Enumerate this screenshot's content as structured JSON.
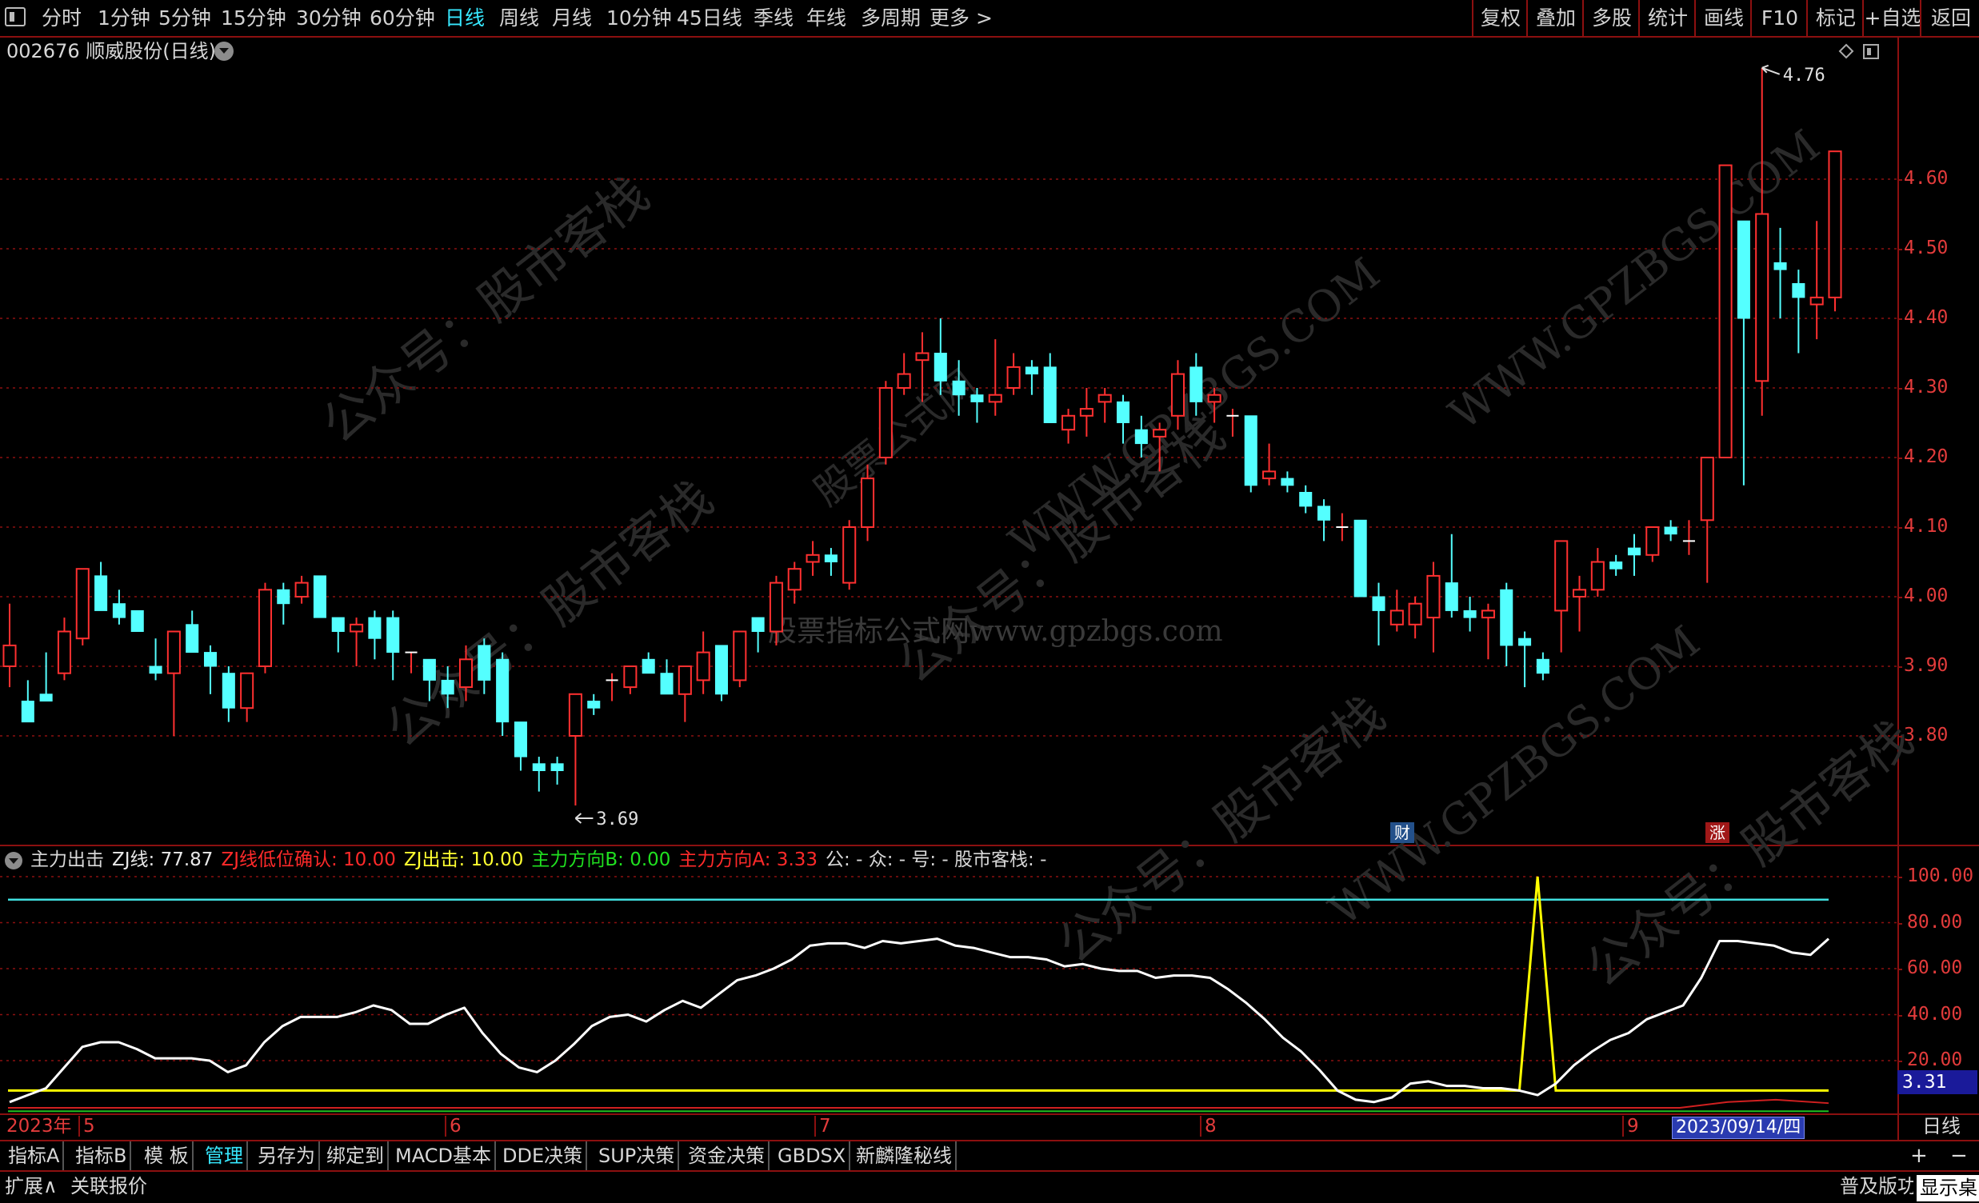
{
  "toolbar": {
    "periods": [
      "分时",
      "1分钟",
      "5分钟",
      "15分钟",
      "30分钟",
      "60分钟",
      "日线",
      "周线",
      "月线",
      "10分钟",
      "45日线",
      "季线",
      "年线",
      "多周期",
      "更多 >"
    ],
    "active_period": "日线",
    "right_buttons": [
      "复权",
      "叠加",
      "多股",
      "统计",
      "画线",
      "F10",
      "标记",
      "+自选",
      "返回"
    ]
  },
  "title": "002676 顺威股份(日线)",
  "price_axis": {
    "labels": [
      "4.60",
      "4.50",
      "4.40",
      "4.30",
      "4.20",
      "4.10",
      "4.00",
      "3.90",
      "3.80"
    ]
  },
  "annotations": {
    "high": "4.76",
    "low": "3.69",
    "badge_cai": "财",
    "badge_zhang": "涨"
  },
  "watermarks": {
    "center": "股票指标公式网www.gpzbgs.com",
    "wechat": "公众号：股市客栈",
    "site": "WWW.GPZBGS.COM",
    "site_cn": "股票公式网"
  },
  "indicator": {
    "name": "主力出击",
    "zj": "ZJ线: 77.87",
    "zj_low": "ZJ线低位确认: 10.00",
    "zj_attack": "ZJ出击: 10.00",
    "dir_b": "主力方向B: 0.00",
    "dir_a": "主力方向A: 3.33",
    "extra": "公: -  众: -  号: -  股市客栈: -",
    "axis_labels": [
      "100.00",
      "80.00",
      "60.00",
      "40.00",
      "20.00"
    ],
    "current_value": "3.31"
  },
  "date_axis": {
    "year": "2023年",
    "months": [
      "5",
      "6",
      "7",
      "8",
      "9"
    ],
    "current_date": "2023/09/14/四",
    "period": "日线"
  },
  "bottom_tabs": [
    "指标A",
    "指标B",
    "模 板",
    "管理",
    "另存为",
    "绑定到",
    "MACD基本",
    "DDE决策",
    "SUP决策",
    "资金决策",
    "GBDSX",
    "新麟隆秘线"
  ],
  "active_tab": "管理",
  "status_bar": {
    "expand": "扩展∧",
    "linked_quote": "关联报价",
    "right1": "普及版功",
    "right2": "显示桌"
  },
  "colors": {
    "up": "#ff3030",
    "down": "#54ffff",
    "frame": "#8c1010",
    "zj_line": "#ffffff",
    "threshold": "#ffff00",
    "upper_line": "#40e0e0"
  },
  "chart_data": [
    {
      "type": "candlestick",
      "title": "002676 顺威股份(日线)",
      "ylim": [
        3.65,
        4.8
      ],
      "ticks": [
        4.6,
        4.5,
        4.4,
        4.3,
        4.2,
        4.1,
        4.0,
        3.9,
        3.8
      ],
      "candles": [
        [
          3.9,
          3.99,
          3.93,
          3.87
        ],
        [
          3.85,
          3.88,
          3.82,
          3.83
        ],
        [
          3.86,
          3.92,
          3.85,
          3.85
        ],
        [
          3.89,
          3.97,
          3.95,
          3.88
        ],
        [
          3.94,
          4.03,
          4.04,
          3.93
        ],
        [
          4.03,
          4.05,
          3.98,
          4.01
        ],
        [
          3.99,
          4.01,
          3.97,
          3.96
        ],
        [
          3.98,
          3.9,
          3.95,
          3.9
        ],
        [
          3.9,
          3.94,
          3.89,
          3.88
        ],
        [
          3.89,
          3.95,
          3.95,
          3.8
        ],
        [
          3.96,
          3.98,
          3.92,
          3.92
        ],
        [
          3.92,
          3.93,
          3.9,
          3.86
        ],
        [
          3.89,
          3.9,
          3.84,
          3.82
        ],
        [
          3.84,
          3.88,
          3.89,
          3.82
        ],
        [
          3.9,
          4.02,
          4.01,
          3.89
        ],
        [
          4.01,
          4.02,
          3.99,
          3.96
        ],
        [
          4.0,
          4.03,
          4.02,
          3.99
        ],
        [
          4.03,
          4.03,
          3.97,
          3.97
        ],
        [
          3.97,
          3.97,
          3.95,
          3.92
        ],
        [
          3.95,
          3.97,
          3.96,
          3.9
        ],
        [
          3.97,
          3.98,
          3.94,
          3.91
        ],
        [
          3.97,
          3.98,
          3.92,
          3.88
        ],
        [
          3.92,
          3.92,
          3.92,
          3.89
        ],
        [
          3.91,
          3.89,
          3.88,
          3.85
        ],
        [
          3.88,
          3.9,
          3.86,
          3.84
        ],
        [
          3.87,
          3.93,
          3.91,
          3.85
        ],
        [
          3.93,
          3.94,
          3.88,
          3.86
        ],
        [
          3.91,
          3.92,
          3.82,
          3.8
        ],
        [
          3.82,
          3.82,
          3.77,
          3.75
        ],
        [
          3.76,
          3.77,
          3.75,
          3.72
        ],
        [
          3.76,
          3.77,
          3.75,
          3.73
        ],
        [
          3.8,
          3.86,
          3.86,
          3.7
        ],
        [
          3.85,
          3.86,
          3.84,
          3.83
        ],
        [
          3.88,
          3.89,
          3.88,
          3.85
        ],
        [
          3.87,
          3.9,
          3.9,
          3.86
        ],
        [
          3.91,
          3.92,
          3.89,
          3.89
        ],
        [
          3.89,
          3.91,
          3.86,
          3.86
        ],
        [
          3.86,
          3.9,
          3.9,
          3.82
        ],
        [
          3.88,
          3.95,
          3.92,
          3.86
        ],
        [
          3.93,
          3.93,
          3.86,
          3.85
        ],
        [
          3.88,
          3.95,
          3.95,
          3.87
        ],
        [
          3.97,
          3.97,
          3.95,
          3.92
        ],
        [
          3.95,
          4.03,
          4.02,
          3.93
        ],
        [
          4.01,
          4.05,
          4.04,
          3.99
        ],
        [
          4.05,
          4.08,
          4.06,
          4.03
        ],
        [
          4.06,
          4.07,
          4.05,
          4.03
        ],
        [
          4.02,
          4.11,
          4.1,
          4.01
        ],
        [
          4.1,
          4.19,
          4.17,
          4.08
        ],
        [
          4.2,
          4.31,
          4.3,
          4.19
        ],
        [
          4.3,
          4.35,
          4.32,
          4.29
        ],
        [
          4.34,
          4.38,
          4.35,
          4.28
        ],
        [
          4.35,
          4.4,
          4.31,
          4.29
        ],
        [
          4.31,
          4.34,
          4.29,
          4.26
        ],
        [
          4.29,
          4.3,
          4.28,
          4.25
        ],
        [
          4.28,
          4.37,
          4.29,
          4.26
        ],
        [
          4.3,
          4.35,
          4.33,
          4.29
        ],
        [
          4.33,
          4.34,
          4.32,
          4.29
        ],
        [
          4.33,
          4.35,
          4.25,
          4.25
        ],
        [
          4.24,
          4.27,
          4.26,
          4.22
        ],
        [
          4.26,
          4.3,
          4.27,
          4.23
        ],
        [
          4.28,
          4.3,
          4.29,
          4.25
        ],
        [
          4.28,
          4.29,
          4.25,
          4.22
        ],
        [
          4.24,
          4.26,
          4.22,
          4.2
        ],
        [
          4.23,
          4.25,
          4.24,
          4.18
        ],
        [
          4.26,
          4.34,
          4.32,
          4.24
        ],
        [
          4.33,
          4.35,
          4.28,
          4.26
        ],
        [
          4.28,
          4.3,
          4.29,
          4.25
        ],
        [
          4.26,
          4.27,
          4.26,
          4.23
        ],
        [
          4.26,
          4.26,
          4.16,
          4.15
        ],
        [
          4.17,
          4.22,
          4.18,
          4.16
        ],
        [
          4.17,
          4.18,
          4.16,
          4.15
        ],
        [
          4.15,
          4.16,
          4.13,
          4.12
        ],
        [
          4.13,
          4.14,
          4.11,
          4.08
        ],
        [
          4.1,
          4.12,
          4.1,
          4.08
        ],
        [
          4.11,
          4.11,
          4.0,
          4.0
        ],
        [
          4.0,
          4.02,
          3.98,
          3.93
        ],
        [
          3.96,
          4.01,
          3.98,
          3.95
        ],
        [
          3.96,
          4.0,
          3.99,
          3.94
        ],
        [
          3.97,
          4.05,
          4.03,
          3.92
        ],
        [
          4.02,
          4.09,
          3.98,
          3.97
        ],
        [
          3.98,
          4.0,
          3.97,
          3.95
        ],
        [
          3.97,
          3.99,
          3.98,
          3.91
        ],
        [
          4.01,
          4.02,
          3.93,
          3.9
        ],
        [
          3.94,
          3.95,
          3.93,
          3.87
        ],
        [
          3.91,
          3.92,
          3.89,
          3.88
        ],
        [
          3.98,
          3.98,
          4.08,
          3.92
        ],
        [
          4.0,
          4.03,
          4.01,
          3.95
        ],
        [
          4.01,
          4.07,
          4.05,
          4.0
        ],
        [
          4.05,
          4.06,
          4.04,
          4.03
        ],
        [
          4.07,
          4.09,
          4.06,
          4.03
        ],
        [
          4.06,
          4.1,
          4.1,
          4.05
        ],
        [
          4.1,
          4.11,
          4.09,
          4.08
        ],
        [
          4.08,
          4.11,
          4.08,
          4.06
        ],
        [
          4.11,
          4.2,
          4.2,
          4.02
        ],
        [
          4.2,
          4.62,
          4.62,
          4.2
        ],
        [
          4.54,
          4.54,
          4.4,
          4.16
        ],
        [
          4.31,
          4.76,
          4.55,
          4.26
        ],
        [
          4.48,
          4.53,
          4.47,
          4.4
        ],
        [
          4.45,
          4.47,
          4.43,
          4.35
        ],
        [
          4.42,
          4.54,
          4.43,
          4.37
        ],
        [
          4.43,
          4.64,
          4.64,
          4.41
        ]
      ],
      "high_label": "4.76",
      "low_label": "3.69"
    },
    {
      "type": "line",
      "title": "主力出击",
      "ylim": [
        -10,
        105
      ],
      "ticks": [
        100,
        80,
        60,
        40,
        20
      ],
      "series": [
        {
          "name": "ZJ线",
          "values": [
            2,
            5,
            8,
            17,
            26,
            28,
            28,
            25,
            21,
            21,
            21,
            20,
            15,
            18,
            28,
            35,
            39,
            39,
            39,
            41,
            44,
            42,
            36,
            36,
            40,
            43,
            32,
            23,
            17,
            15,
            20,
            27,
            35,
            39,
            40,
            37,
            42,
            46,
            43,
            49,
            55,
            57,
            60,
            64,
            70,
            71,
            71,
            69,
            72,
            71,
            72,
            73,
            70,
            69,
            67,
            65,
            65,
            64,
            61,
            62,
            60,
            59,
            59,
            56,
            57,
            57,
            56,
            51,
            45,
            38,
            30,
            24,
            16,
            7,
            3,
            2,
            4,
            10,
            11,
            9,
            9,
            8,
            8,
            7,
            5,
            10,
            18,
            24,
            29,
            32,
            38,
            41,
            44,
            56,
            72,
            72,
            71,
            70,
            67,
            66,
            73
          ]
        },
        {
          "name": "ZJ出击",
          "values": [
            7,
            7,
            7,
            7,
            7,
            7,
            7,
            7,
            7,
            7,
            7,
            7,
            7,
            7,
            7,
            7,
            7,
            7,
            7,
            7,
            7,
            7,
            7,
            7,
            7,
            7,
            7,
            7,
            7,
            7,
            7,
            7,
            7,
            7,
            7,
            7,
            7,
            7,
            7,
            7,
            7,
            7,
            7,
            7,
            7,
            7,
            7,
            7,
            7,
            7,
            7,
            7,
            7,
            7,
            7,
            7,
            7,
            7,
            7,
            7,
            7,
            7,
            7,
            7,
            7,
            7,
            7,
            7,
            7,
            7,
            7,
            7,
            7,
            7,
            7,
            7,
            7,
            7,
            7,
            7,
            7,
            7,
            7,
            7,
            7,
            7,
            7,
            7,
            7,
            7,
            7,
            7,
            7,
            7,
            7,
            7,
            7,
            7,
            7,
            7,
            7
          ]
        },
        {
          "name": "ZJ线低位确认",
          "values": [
            100
          ]
        },
        {
          "name": "upper",
          "values": [
            90
          ]
        }
      ]
    }
  ]
}
